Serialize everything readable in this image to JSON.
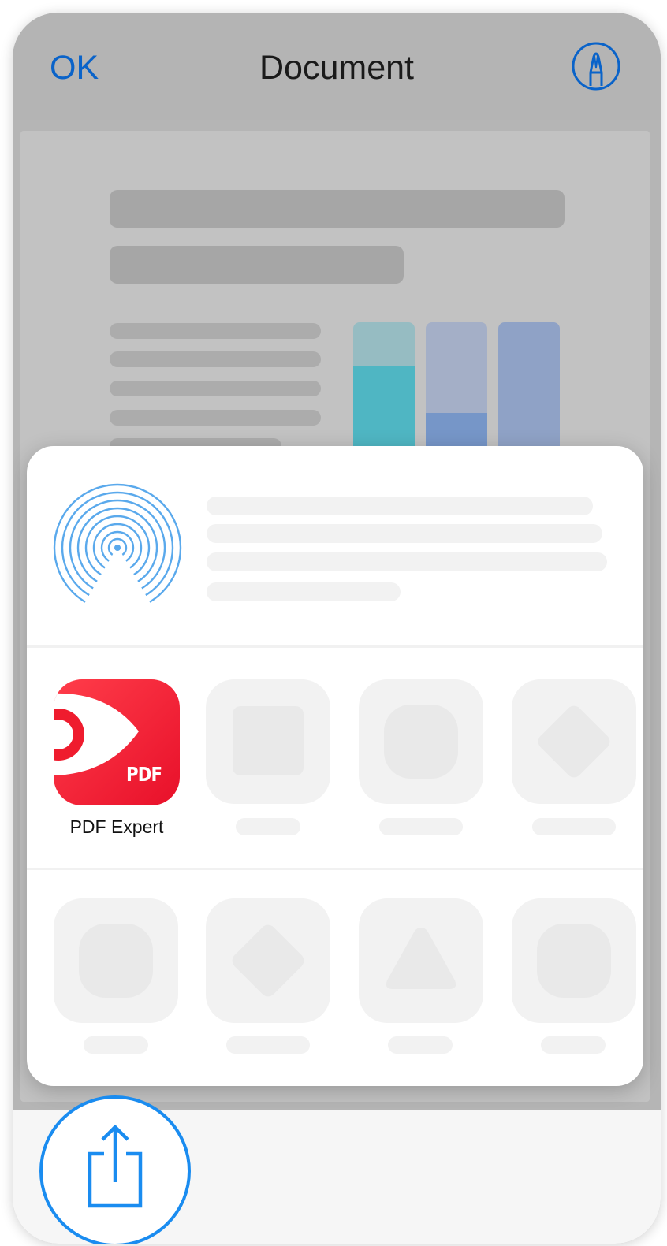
{
  "navbar": {
    "ok_label": "OK",
    "title": "Document"
  },
  "icons": {
    "markup": "markup-pen-icon",
    "airdrop": "airdrop-icon",
    "share": "share-icon",
    "pdf_expert": "pdf-expert-app-icon"
  },
  "share_sheet": {
    "apps": [
      {
        "label": "PDF Expert",
        "icon_text": "PDF"
      }
    ]
  },
  "document_chart": {
    "columns": [
      {
        "fill_fraction": 0.76
      },
      {
        "fill_fraction": 0.5
      },
      {
        "fill_fraction": 0.19
      }
    ]
  },
  "colors": {
    "accent": "#0a63c9",
    "share_blue": "#1a8cf0",
    "airdrop_blue": "#5aa9ec",
    "pdf_red": "#f01b2e"
  }
}
